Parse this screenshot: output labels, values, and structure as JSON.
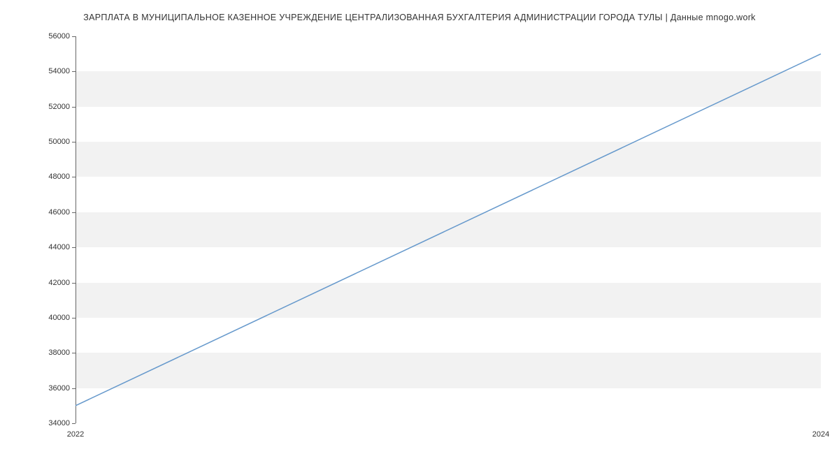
{
  "chart_data": {
    "type": "line",
    "title": "ЗАРПЛАТА В МУНИЦИПАЛЬНОЕ КАЗЕННОЕ УЧРЕЖДЕНИЕ ЦЕНТРАЛИЗОВАННАЯ БУХГАЛТЕРИЯ АДМИНИСТРАЦИИ ГОРОДА ТУЛЫ | Данные mnogo.work",
    "xlabel": "",
    "ylabel": "",
    "x": [
      2022,
      2024
    ],
    "values": [
      35000,
      55000
    ],
    "xlim": [
      2022,
      2024
    ],
    "ylim": [
      34000,
      56000
    ],
    "y_ticks": [
      34000,
      36000,
      38000,
      40000,
      42000,
      44000,
      46000,
      48000,
      50000,
      52000,
      54000,
      56000
    ],
    "x_ticks": [
      2022,
      2024
    ],
    "grid_bands": [
      [
        36000,
        38000
      ],
      [
        40000,
        42000
      ],
      [
        44000,
        46000
      ],
      [
        48000,
        50000
      ],
      [
        52000,
        54000
      ]
    ],
    "line_color": "#6699cc"
  }
}
